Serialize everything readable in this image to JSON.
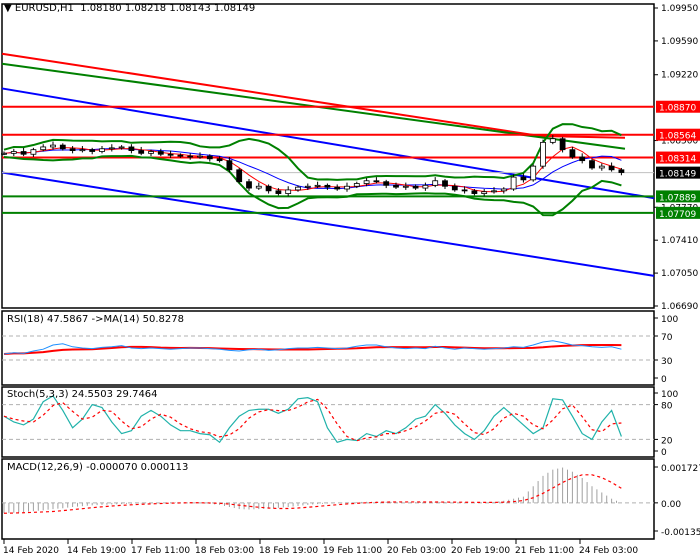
{
  "header": {
    "symbol": "EURUSD,H1",
    "open": "1.08180",
    "high": "1.08218",
    "low": "1.08143",
    "close": "1.08149"
  },
  "colors": {
    "bull_red": "#ff0000",
    "green": "#008000",
    "blue": "#0000ff",
    "rsi": "#1e90ff",
    "stoch": "#20b2aa"
  },
  "price_axis": {
    "ticks": [
      "1.09950",
      "1.09590",
      "1.09220",
      "1.08500",
      "1.07770",
      "1.07410",
      "1.07050",
      "1.06690"
    ],
    "range": [
      1.0669,
      1.0995
    ]
  },
  "levels": [
    {
      "label": "1.08870",
      "value": 1.0887,
      "color": "#ff0000"
    },
    {
      "label": "1.08564",
      "value": 1.08564,
      "color": "#ff0000"
    },
    {
      "label": "1.08314",
      "value": 1.08314,
      "color": "#ff0000"
    },
    {
      "label": "1.07889",
      "value": 1.07889,
      "color": "#008000"
    },
    {
      "label": "1.07709",
      "value": 1.07709,
      "color": "#008000"
    }
  ],
  "current_price": {
    "label": "1.08149",
    "value": 1.08149
  },
  "channel": {
    "upper": [
      1.0907,
      1.0787
    ],
    "lower": [
      1.0815,
      1.0702
    ]
  },
  "long_ma_red": [
    1.0945,
    1.0855,
    1.0853
  ],
  "long_ma_green": [
    1.0934,
    1.0841
  ],
  "closes": [
    1.0836,
    1.0838,
    1.0835,
    1.084,
    1.0843,
    1.0845,
    1.0841,
    1.0839,
    1.084,
    1.0838,
    1.0841,
    1.0842,
    1.0843,
    1.0839,
    1.0836,
    1.0838,
    1.0835,
    1.0834,
    1.0833,
    1.0832,
    1.0833,
    1.083,
    1.0828,
    1.0818,
    1.0805,
    1.0798,
    1.08,
    1.0795,
    1.0792,
    1.0796,
    1.0799,
    1.08,
    1.0801,
    1.0799,
    1.0797,
    1.08,
    1.0803,
    1.0806,
    1.0805,
    1.0801,
    1.0799,
    1.08,
    1.0798,
    1.0801,
    1.0806,
    1.08,
    1.0796,
    1.0795,
    1.0792,
    1.0794,
    1.0795,
    1.0797,
    1.081,
    1.0807,
    1.0822,
    1.0848,
    1.0852,
    1.084,
    1.0832,
    1.0828,
    1.082,
    1.0822,
    1.0818,
    1.0815
  ],
  "rsi": {
    "title": "RSI(18) 47.5867  ->MA(14) 50.8278",
    "ticks": [
      "100",
      "70",
      "30",
      "0"
    ],
    "values": [
      40,
      42,
      41,
      45,
      48,
      55,
      57,
      52,
      50,
      49,
      51,
      52,
      54,
      50,
      49,
      50,
      49,
      48,
      49,
      50,
      50,
      49,
      48,
      46,
      45,
      47,
      48,
      46,
      47,
      49,
      50,
      50,
      51,
      50,
      49,
      50,
      53,
      55,
      55,
      52,
      50,
      49,
      50,
      49,
      53,
      50,
      48,
      50,
      49,
      48,
      49,
      50,
      52,
      51,
      55,
      60,
      62,
      59,
      55,
      54,
      52,
      51,
      52,
      48
    ]
  },
  "stoch": {
    "title": "Stoch(5,3,3) 24.5503 29.7464",
    "ticks": [
      "100",
      "80",
      "20",
      "0"
    ],
    "values": [
      60,
      50,
      45,
      55,
      85,
      95,
      70,
      40,
      55,
      80,
      75,
      50,
      30,
      35,
      60,
      70,
      60,
      45,
      35,
      35,
      30,
      28,
      15,
      40,
      60,
      70,
      72,
      72,
      65,
      72,
      90,
      92,
      85,
      40,
      15,
      20,
      18,
      30,
      25,
      35,
      30,
      40,
      55,
      60,
      80,
      65,
      45,
      30,
      20,
      35,
      60,
      75,
      60,
      45,
      30,
      40,
      90,
      88,
      60,
      30,
      20,
      50,
      70,
      25
    ]
  },
  "macd": {
    "title": "MACD(12,26,9) -0.000070 0.000113",
    "ticks": [
      "0.001727",
      "0.00",
      "-0.001356"
    ],
    "range": [
      -0.001356,
      0.001727
    ],
    "values": [
      -0.0005,
      -0.00048,
      -0.00045,
      -0.0004,
      -0.00036,
      -0.0003,
      -0.00026,
      -0.0002,
      -0.00016,
      -0.00012,
      -0.0001,
      -8e-05,
      -6e-05,
      -4e-05,
      -2e-05,
      0,
      1e-05,
      2e-05,
      1e-05,
      0,
      -2e-05,
      -5e-05,
      -0.0001,
      -0.0002,
      -0.0003,
      -0.00032,
      -0.0003,
      -0.00028,
      -0.00024,
      -0.0002,
      -0.00015,
      -0.0001,
      -6e-05,
      -3e-05,
      0,
      2e-05,
      4e-05,
      5e-05,
      6e-05,
      5e-05,
      4e-05,
      3e-05,
      3e-05,
      4e-05,
      5e-05,
      4e-05,
      2e-05,
      0,
      0,
      2e-05,
      5e-05,
      0.0001,
      0.0002,
      0.0003,
      0.0008,
      0.0013,
      0.0016,
      0.0017,
      0.0015,
      0.0012,
      0.0008,
      0.0005,
      0.0002,
      0
    ]
  },
  "time_axis": [
    "14 Feb 2020",
    "14 Feb 19:00",
    "17 Feb 11:00",
    "18 Feb 03:00",
    "18 Feb 19:00",
    "19 Feb 11:00",
    "20 Feb 03:00",
    "20 Feb 19:00",
    "21 Feb 11:00",
    "24 Feb 03:00"
  ]
}
